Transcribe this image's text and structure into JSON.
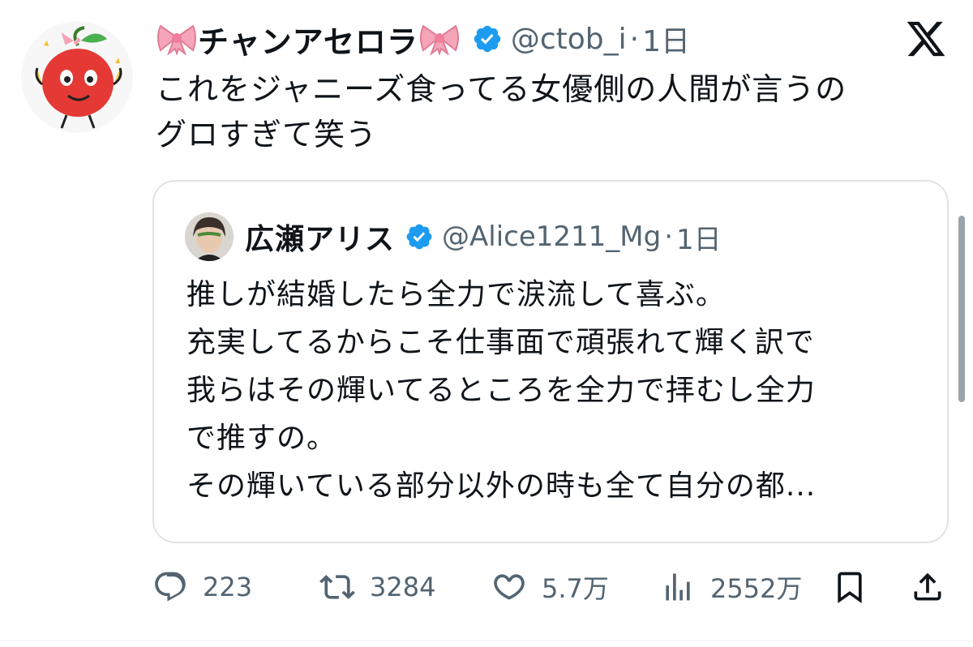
{
  "tweet": {
    "display_name": "チャンアセロラ",
    "handle": "@ctob_i",
    "separator": "·",
    "time": "1日",
    "text_lines": [
      "これをジャニーズ食ってる女優側の人間が言うの",
      "グロすぎて笑う"
    ]
  },
  "quote": {
    "display_name": "広瀬アリス",
    "handle": "@Alice1211_Mg",
    "separator": "·",
    "time": "1日",
    "text_lines": [
      "推しが結婚したら全力で涙流して喜ぶ。",
      "充実してるからこそ仕事面で頑張れて輝く訳で",
      "我らはその輝いてるところを全力で拝むし全力",
      "で推すの。",
      "その輝いている部分以外の時も全て自分の都..."
    ]
  },
  "actions": {
    "replies": "223",
    "reposts": "3284",
    "likes": "5.7万",
    "views": "2552万"
  },
  "icons": {
    "platform": "x-logo-icon",
    "verified": "verified-badge-icon",
    "reply": "speech-bubble-icon",
    "repost": "repost-arrows-icon",
    "like": "heart-icon",
    "views": "bar-chart-icon",
    "bookmark": "bookmark-icon",
    "share": "share-upload-icon"
  },
  "colors": {
    "verified": "#1d9bf0",
    "text": "#0f1419",
    "secondary_text": "#536471",
    "border": "#dfe3e6",
    "bow": "#f4a6b8"
  }
}
